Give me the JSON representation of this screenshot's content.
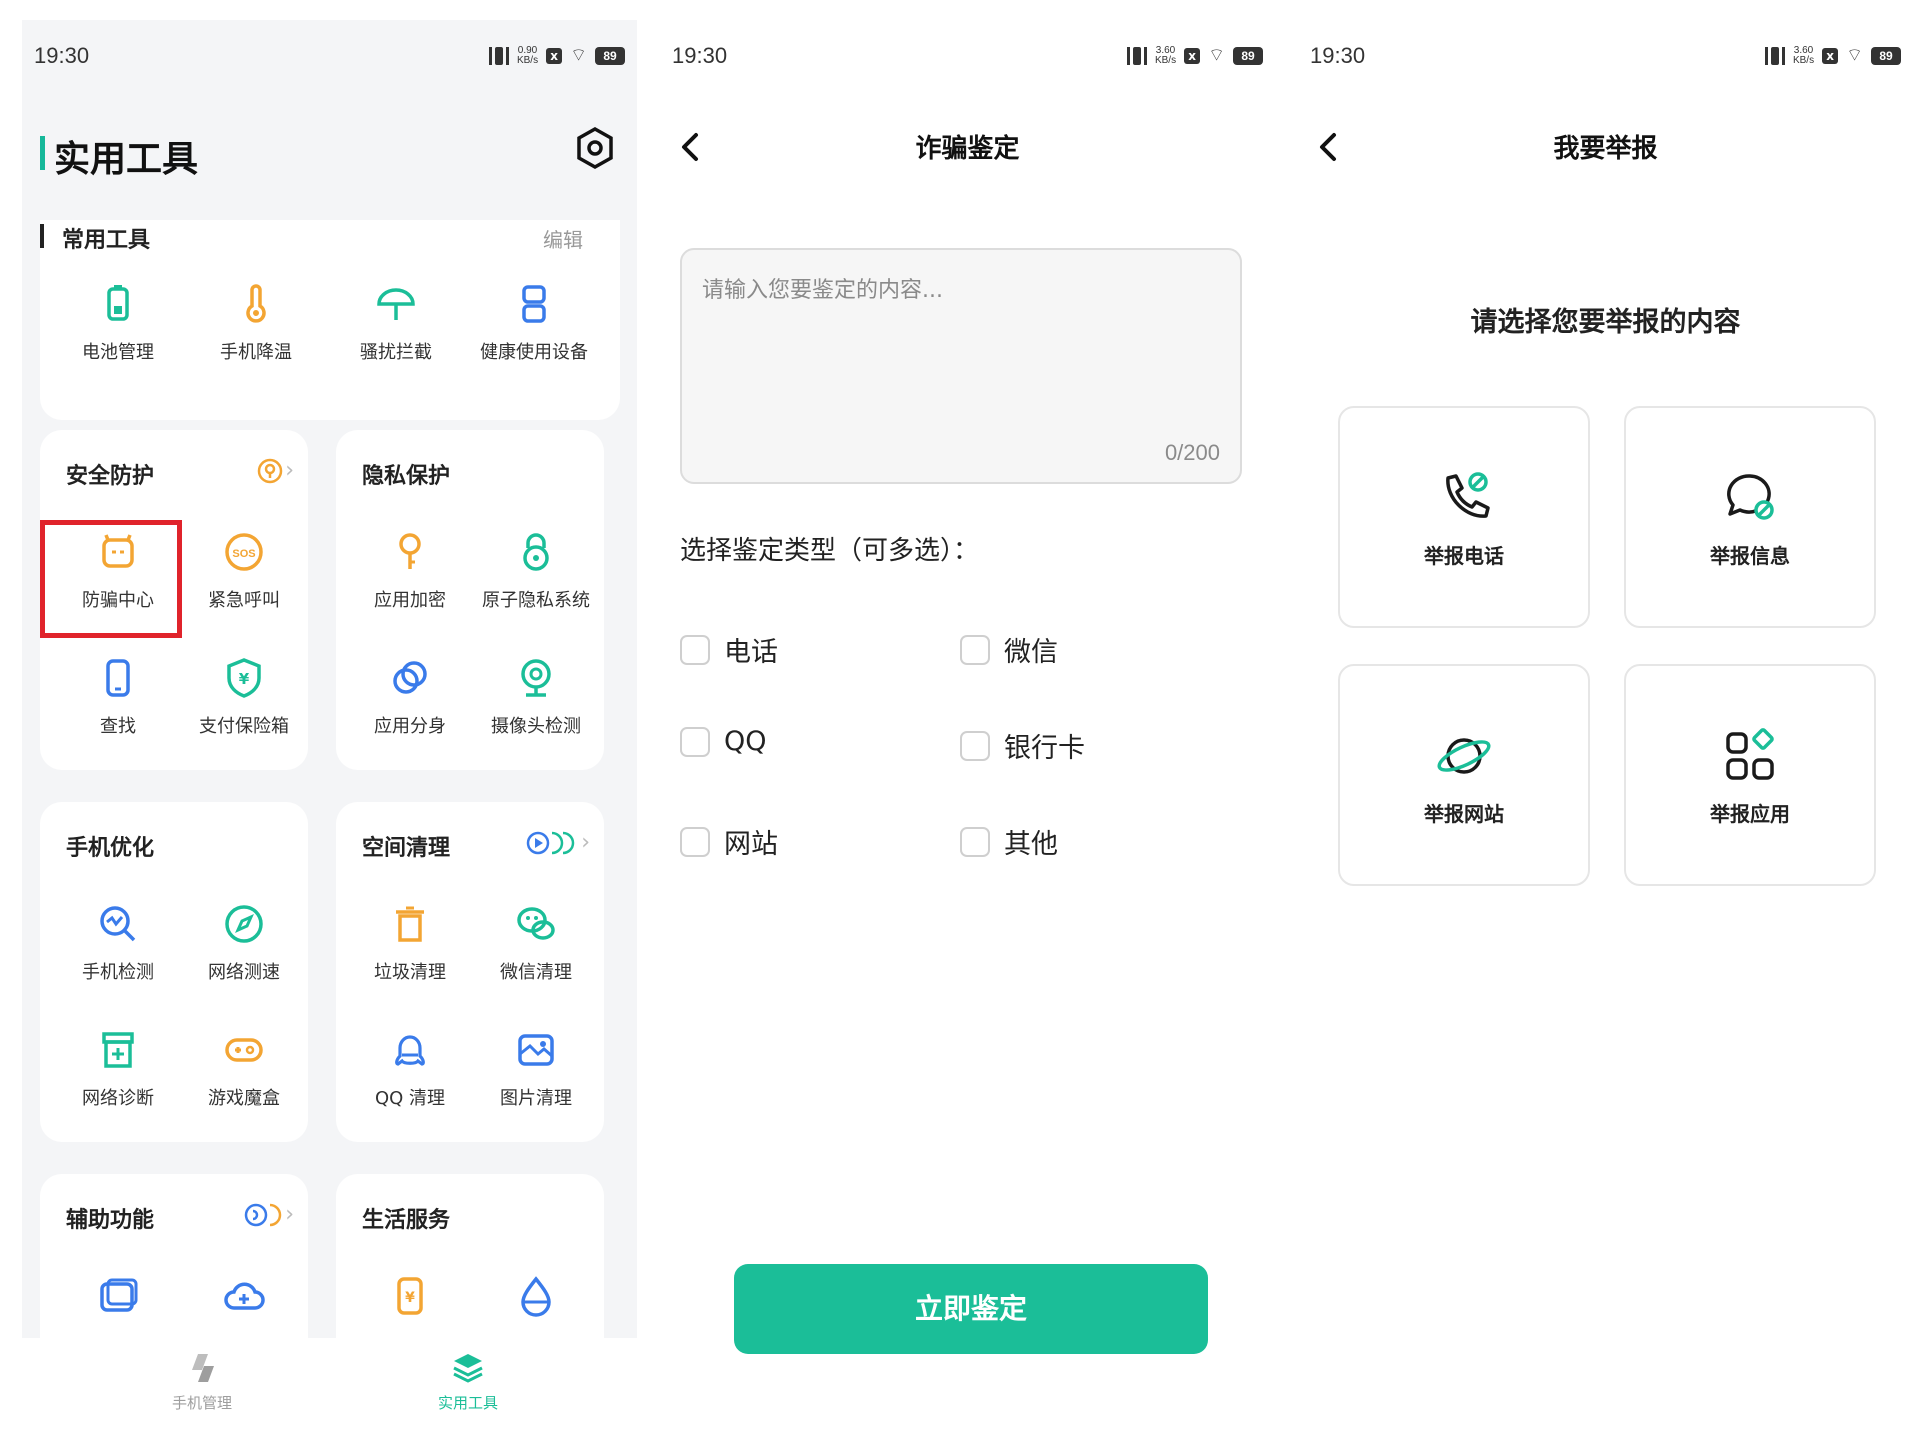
{
  "status": {
    "time": "19:30",
    "battery": "89",
    "speed_p1": "0.90\nKB/s",
    "speed_p2": "3.60\nKB/s",
    "speed_p3": "3.60\nKB/s"
  },
  "tools_page": {
    "title": "实用工具",
    "common": {
      "heading": "常用工具",
      "edit_label": "编辑",
      "items": [
        {
          "label": "电池管理",
          "icon": "battery-icon"
        },
        {
          "label": "手机降温",
          "icon": "thermometer-icon"
        },
        {
          "label": "骚扰拦截",
          "icon": "umbrella-icon"
        },
        {
          "label": "健康使用设备",
          "icon": "hourglass-icon"
        }
      ]
    },
    "security": {
      "heading": "安全防护",
      "items": [
        {
          "label": "防骗中心",
          "icon": "anti-fraud-icon"
        },
        {
          "label": "紧急呼叫",
          "icon": "sos-icon"
        },
        {
          "label": "查找",
          "icon": "find-phone-icon"
        },
        {
          "label": "支付保险箱",
          "icon": "payment-shield-icon"
        }
      ]
    },
    "privacy": {
      "heading": "隐私保护",
      "items": [
        {
          "label": "应用加密",
          "icon": "key-icon"
        },
        {
          "label": "原子隐私系统",
          "icon": "lock-icon"
        },
        {
          "label": "应用分身",
          "icon": "app-clone-icon"
        },
        {
          "label": "摄像头检测",
          "icon": "camera-detect-icon"
        }
      ]
    },
    "optimize": {
      "heading": "手机优化",
      "items": [
        {
          "label": "手机检测",
          "icon": "phone-check-icon"
        },
        {
          "label": "网络测速",
          "icon": "speed-test-icon"
        },
        {
          "label": "网络诊断",
          "icon": "network-diagnosis-icon"
        },
        {
          "label": "游戏魔盒",
          "icon": "gamepad-icon"
        }
      ]
    },
    "cleanup": {
      "heading": "空间清理",
      "items": [
        {
          "label": "垃圾清理",
          "icon": "trash-icon"
        },
        {
          "label": "微信清理",
          "icon": "wechat-icon"
        },
        {
          "label": "QQ 清理",
          "icon": "qq-icon"
        },
        {
          "label": "图片清理",
          "icon": "image-clean-icon"
        }
      ]
    },
    "assist": {
      "heading": "辅助功能"
    },
    "life": {
      "heading": "生活服务"
    },
    "nav": {
      "manage": "手机管理",
      "tools": "实用工具"
    }
  },
  "fraud_page": {
    "title": "诈骗鉴定",
    "input_placeholder": "请输入您要鉴定的内容...",
    "counter": "0/200",
    "type_title": "选择鉴定类型（可多选）：",
    "options": [
      "电话",
      "微信",
      "QQ",
      "银行卡",
      "网站",
      "其他"
    ],
    "submit_label": "立即鉴定"
  },
  "report_page": {
    "title": "我要举报",
    "prompt": "请选择您要举报的内容",
    "items": [
      {
        "label": "举报电话",
        "icon": "report-phone-icon"
      },
      {
        "label": "举报信息",
        "icon": "report-message-icon"
      },
      {
        "label": "举报网站",
        "icon": "report-website-icon"
      },
      {
        "label": "举报应用",
        "icon": "report-app-icon"
      }
    ]
  },
  "colors": {
    "accent": "#1bbe98",
    "blue": "#3a7bea",
    "orange": "#f3a533",
    "highlight": "#e0232b"
  }
}
